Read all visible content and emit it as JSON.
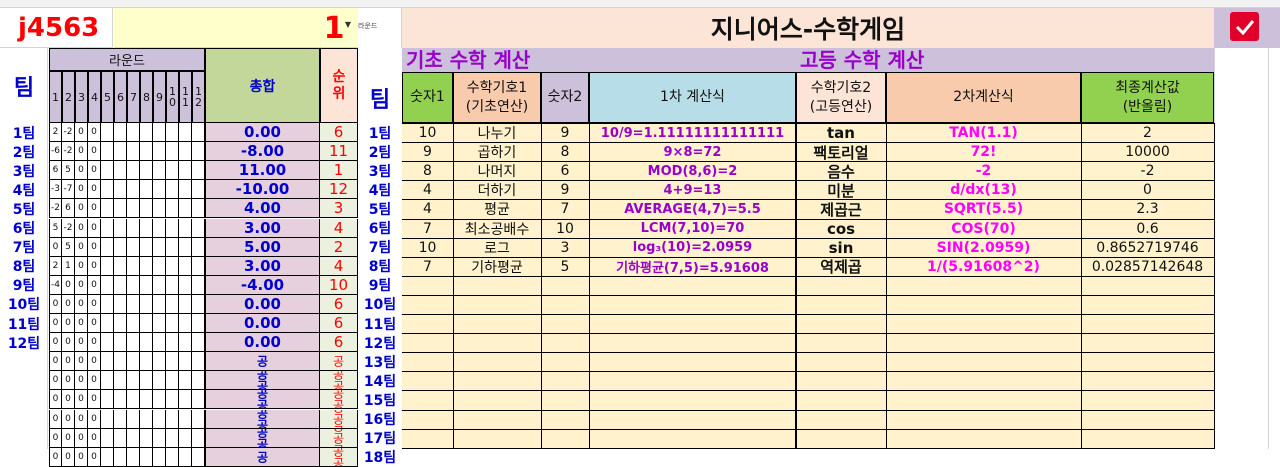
{
  "header": {
    "code": "j4563",
    "round_value": "1",
    "round_small_label": "라운드",
    "title": "지니어스-수학게임",
    "checkbox_checked": true
  },
  "sections": {
    "basic": "기초 수학 계산",
    "advanced": "고등 수학 계산"
  },
  "left_table": {
    "team_header": "팀",
    "round_header": "라운드",
    "round_numbers": [
      "1",
      "2",
      "3",
      "4",
      "5",
      "6",
      "7",
      "8",
      "9",
      "1\n0",
      "1\n1",
      "1\n2"
    ],
    "total_header": "총합",
    "rank_header": "순\n위",
    "rows": [
      {
        "team": "1팀",
        "r": [
          "2",
          "-2",
          "0",
          "0"
        ],
        "total": "0.00",
        "rank": "6"
      },
      {
        "team": "2팀",
        "r": [
          "-6",
          "-2",
          "0",
          "0"
        ],
        "total": "-8.00",
        "rank": "11"
      },
      {
        "team": "3팀",
        "r": [
          "6",
          "5",
          "0",
          "0"
        ],
        "total": "11.00",
        "rank": "1"
      },
      {
        "team": "4팀",
        "r": [
          "-3",
          "-7",
          "0",
          "0"
        ],
        "total": "-10.00",
        "rank": "12"
      },
      {
        "team": "5팀",
        "r": [
          "-2",
          "6",
          "0",
          "0"
        ],
        "total": "4.00",
        "rank": "3"
      },
      {
        "team": "6팀",
        "r": [
          "5",
          "-2",
          "0",
          "0"
        ],
        "total": "3.00",
        "rank": "4"
      },
      {
        "team": "7팀",
        "r": [
          "0",
          "5",
          "0",
          "0"
        ],
        "total": "5.00",
        "rank": "2"
      },
      {
        "team": "8팀",
        "r": [
          "2",
          "1",
          "0",
          "0"
        ],
        "total": "3.00",
        "rank": "4"
      },
      {
        "team": "9팀",
        "r": [
          "-4",
          "0",
          "0",
          "0"
        ],
        "total": "-4.00",
        "rank": "10"
      },
      {
        "team": "10팀",
        "r": [
          "0",
          "0",
          "0",
          "0"
        ],
        "total": "0.00",
        "rank": "6"
      },
      {
        "team": "11팀",
        "r": [
          "0",
          "0",
          "0",
          "0"
        ],
        "total": "0.00",
        "rank": "6"
      },
      {
        "team": "12팀",
        "r": [
          "0",
          "0",
          "0",
          "0"
        ],
        "total": "0.00",
        "rank": "6"
      },
      {
        "team": "",
        "r": [
          "0",
          "0",
          "0",
          "0"
        ],
        "total": "공",
        "rank": "공"
      },
      {
        "team": "",
        "r": [
          "0",
          "0",
          "0",
          "0"
        ],
        "total": "공공",
        "rank": "공공"
      },
      {
        "team": "",
        "r": [
          "0",
          "0",
          "0",
          "0"
        ],
        "total": "공공",
        "rank": "공공"
      },
      {
        "team": "",
        "r": [
          "0",
          "0",
          "0",
          "0"
        ],
        "total": "공공",
        "rank": "공공공"
      },
      {
        "team": "",
        "r": [
          "0",
          "0",
          "0",
          "0"
        ],
        "total": "공공",
        "rank": "공공공"
      },
      {
        "team": "",
        "r": [
          "0",
          "0",
          "0",
          "0"
        ],
        "total": "공",
        "rank": "공공"
      }
    ]
  },
  "main_table": {
    "team_header": "팀",
    "headers": {
      "num1": "숫자1",
      "sym1": "수학기호1\n(기초연산)",
      "num2": "숫자2",
      "calc1": "1차 계산식",
      "sym2": "수학기호2\n(고등연산)",
      "calc2": "2차계산식",
      "final": "최종계산값\n(반올림)"
    },
    "team_labels": [
      "1팀",
      "2팀",
      "3팀",
      "4팀",
      "5팀",
      "6팀",
      "7팀",
      "8팀",
      "9팀",
      "10팀",
      "11팀",
      "12팀",
      "13팀",
      "14팀",
      "15팀",
      "16팀",
      "17팀",
      "18팀"
    ],
    "rows": [
      {
        "num1": "10",
        "sym1": "나누기",
        "num2": "9",
        "calc1": "10/9=1.11111111111111",
        "sym2": "tan",
        "calc2": "TAN(1.1)",
        "final": "2"
      },
      {
        "num1": "9",
        "sym1": "곱하기",
        "num2": "8",
        "calc1": "9×8=72",
        "sym2": "팩토리얼",
        "calc2": "72!",
        "final": "10000"
      },
      {
        "num1": "8",
        "sym1": "나머지",
        "num2": "6",
        "calc1": "MOD(8,6)=2",
        "sym2": "음수",
        "calc2": "-2",
        "final": "-2"
      },
      {
        "num1": "4",
        "sym1": "더하기",
        "num2": "9",
        "calc1": "4+9=13",
        "sym2": "미분",
        "calc2": "d/dx(13)",
        "final": "0"
      },
      {
        "num1": "4",
        "sym1": "평균",
        "num2": "7",
        "calc1": "AVERAGE(4,7)=5.5",
        "sym2": "제곱근",
        "calc2": "SQRT(5.5)",
        "final": "2.3"
      },
      {
        "num1": "7",
        "sym1": "최소공배수",
        "num2": "10",
        "calc1": "LCM(7,10)=70",
        "sym2": "cos",
        "calc2": "COS(70)",
        "final": "0.6"
      },
      {
        "num1": "10",
        "sym1": "로그",
        "num2": "3",
        "calc1": "log₃(10)=2.0959",
        "sym2": "sin",
        "calc2": "SIN(2.0959)",
        "final": "0.8652719746"
      },
      {
        "num1": "7",
        "sym1": "기하평균",
        "num2": "5",
        "calc1": "기하평균(7,5)=5.91608",
        "sym2": "역제곱",
        "calc2": "1/(5.91608^2)",
        "final": "0.02857142648"
      }
    ]
  },
  "colors": {
    "red": "#ff0000",
    "blue": "#0000cc",
    "purple": "#9900cc",
    "magenta": "#ff00ff",
    "peach": "#fce4d6",
    "cream": "#fff2cc",
    "lavender": "#ccc0da",
    "green": "#92d050",
    "olive": "#c4d79b",
    "lightblue": "#b7dee8",
    "salmon": "#f8cbad",
    "pink": "#e6d0de",
    "mint": "#ebf1de",
    "checkbox": "#e0002a"
  }
}
